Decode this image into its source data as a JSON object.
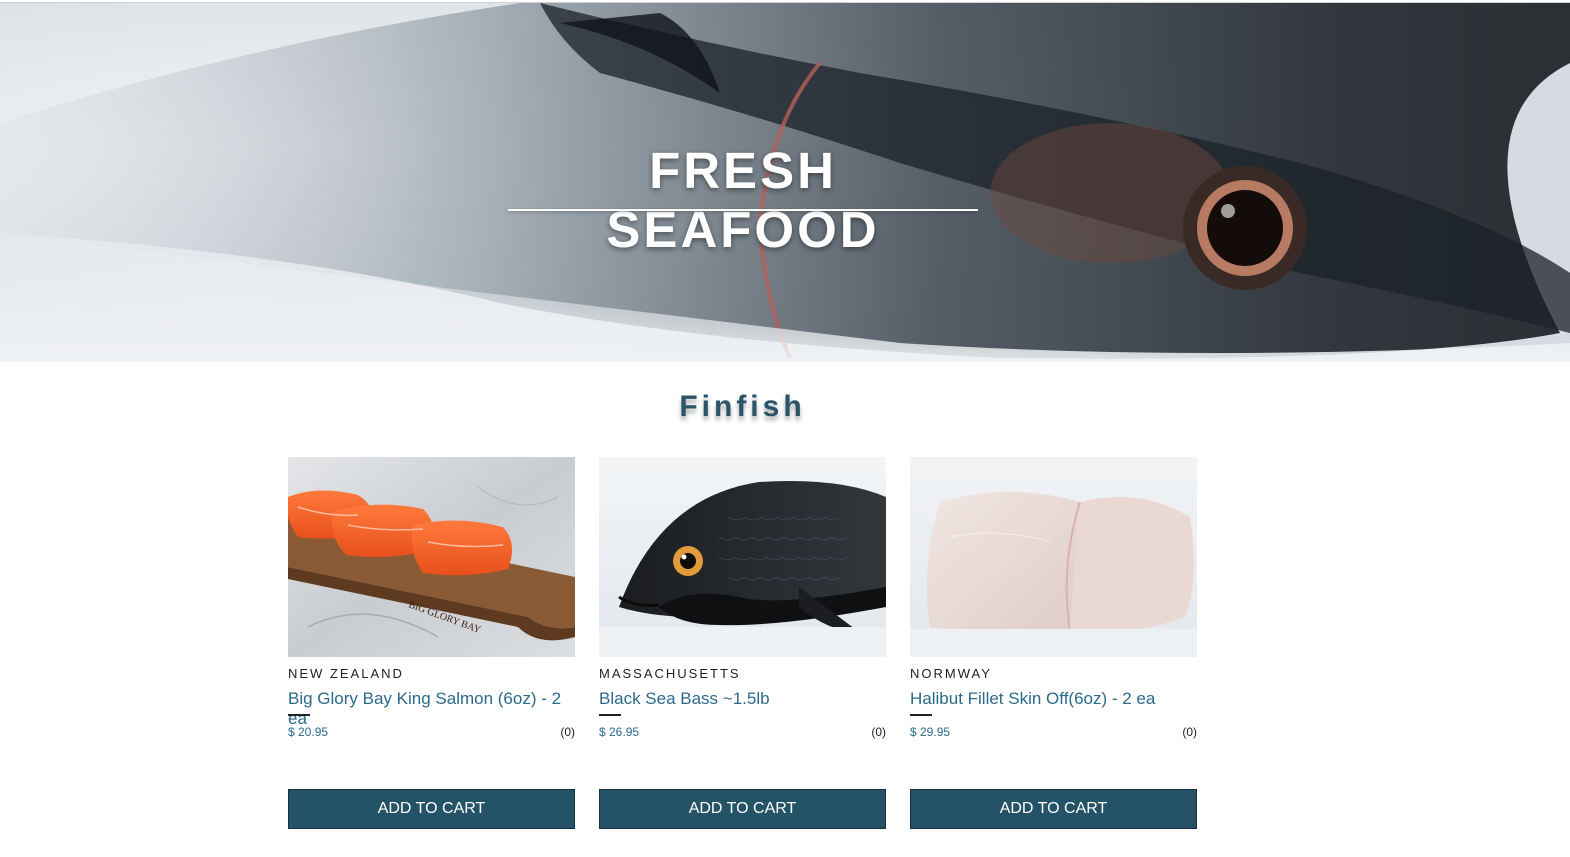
{
  "hero": {
    "title": "FRESH SEAFOOD"
  },
  "section": {
    "title": "Finfish"
  },
  "products": [
    {
      "origin": "NEW ZEALAND",
      "name": "Big Glory Bay King Salmon (6oz) - 2 ea",
      "price": "$ 20.95",
      "count": "(0)",
      "button": "ADD TO CART",
      "board_text": "BIG GLORY BAY"
    },
    {
      "origin": "MASSACHUSETTS",
      "name": "Black Sea Bass ~1.5lb",
      "price": "$ 26.95",
      "count": "(0)",
      "button": "ADD TO CART"
    },
    {
      "origin": "NORMWAY",
      "name": "Halibut Fillet Skin Off(6oz) - 2 ea",
      "price": "$ 29.95",
      "count": "(0)",
      "button": "ADD TO CART"
    }
  ],
  "colors": {
    "accent": "#245267",
    "link": "#2b6b8a",
    "heading": "#2b5468"
  }
}
